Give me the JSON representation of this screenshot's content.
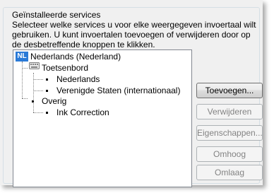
{
  "group": {
    "title": "Geïnstalleerde services",
    "description": "Selecteer welke services u voor elke weergegeven invoertaal wilt gebruiken. U kunt invoertalen toevoegen of verwijderen door op de desbetreffende knoppen te klikken."
  },
  "tree": {
    "language_badge": "NL",
    "language": "Nederlands (Nederland)",
    "keyboard_group": "Toetsenbord",
    "keyboards": [
      "Nederlands",
      "Verenigde Staten (internationaal)"
    ],
    "other_group": "Overig",
    "other_items": [
      "Ink Correction"
    ]
  },
  "buttons": {
    "add": "Toevoegen...",
    "remove": "Verwijderen",
    "properties": "Eigenschappen...",
    "move_up": "Omhoog",
    "move_down": "Omlaag"
  },
  "colors": {
    "badge": "#2a7ad7",
    "panel": "#f0f0f0",
    "disabled_text": "#838383"
  }
}
